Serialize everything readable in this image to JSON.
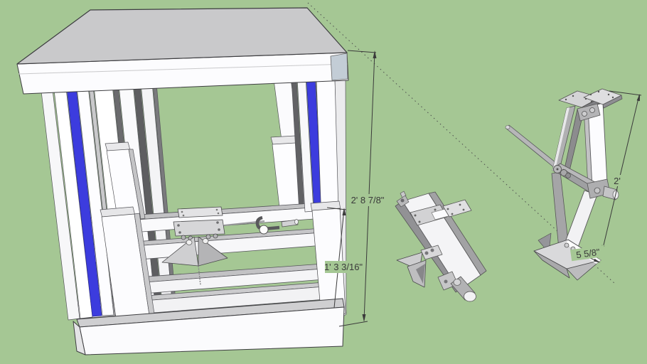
{
  "annotations": {
    "overall_height_label": "2' 8 7/8\"",
    "base_height_label": "1' 3 3/16\"",
    "jack_height_label": "2'",
    "foot_width_label": "5 5/8\""
  },
  "colors": {
    "background": "#a5c794",
    "slide_blue": "#3c3cde",
    "top_surface": "#c9c9cb",
    "dimension_ink": "#3a3a3a"
  }
}
